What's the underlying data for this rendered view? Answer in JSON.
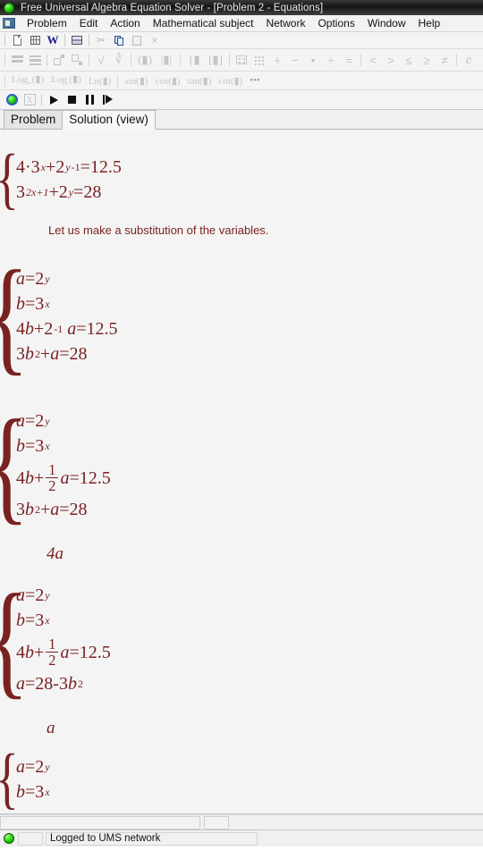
{
  "window": {
    "title": "Free Universal Algebra Equation Solver - [Problem 2 - Equations]",
    "orb_icon": "green-status-orb"
  },
  "menubar": {
    "system_icon": "app-system-icon",
    "items": [
      {
        "label": "Problem"
      },
      {
        "label": "Edit"
      },
      {
        "label": "Action"
      },
      {
        "label": "Mathematical subject"
      },
      {
        "label": "Network"
      },
      {
        "label": "Options"
      },
      {
        "label": "Window"
      },
      {
        "label": "Help"
      }
    ]
  },
  "toolbar_file": {
    "buttons": [
      {
        "name": "new-document-icon",
        "enabled": true
      },
      {
        "name": "table-icon",
        "enabled": true
      },
      {
        "name": "word-export-icon",
        "label": "W",
        "enabled": true
      },
      {
        "name": "print-icon",
        "enabled": true
      },
      {
        "name": "cut-icon",
        "label": "✂",
        "enabled": false
      },
      {
        "name": "copy-icon",
        "enabled": true
      },
      {
        "name": "paste-icon",
        "enabled": false
      },
      {
        "name": "delete-icon",
        "label": "×",
        "enabled": false
      }
    ]
  },
  "toolbar_format": {
    "buttons": [
      {
        "name": "two-row-layout-icon",
        "enabled": false
      },
      {
        "name": "three-row-layout-icon",
        "enabled": false
      },
      {
        "name": "superscript-icon",
        "enabled": false
      },
      {
        "name": "subscript-icon",
        "enabled": false
      },
      {
        "name": "square-root-icon",
        "label": "√",
        "enabled": false
      },
      {
        "name": "nth-root-icon",
        "label": "∛",
        "enabled": false
      },
      {
        "name": "parenthesis-icon",
        "label": "(▮)",
        "enabled": false
      },
      {
        "name": "absolute-value-icon",
        "label": "|▮|",
        "enabled": false
      },
      {
        "name": "brace-icon",
        "label": "{▮",
        "enabled": false
      },
      {
        "name": "bracket-icon",
        "label": "[▮]",
        "enabled": false
      },
      {
        "name": "matrix-small-icon",
        "enabled": false
      },
      {
        "name": "matrix-large-icon",
        "enabled": false
      },
      {
        "name": "plus-operator",
        "label": "+",
        "enabled": false
      },
      {
        "name": "minus-operator",
        "label": "−",
        "enabled": false
      },
      {
        "name": "multiply-operator",
        "label": "•",
        "enabled": false
      },
      {
        "name": "divide-operator",
        "label": "÷",
        "enabled": false
      },
      {
        "name": "equals-operator",
        "label": "=",
        "enabled": false
      },
      {
        "name": "less-than-operator",
        "label": "<",
        "enabled": false
      },
      {
        "name": "greater-than-operator",
        "label": ">",
        "enabled": false
      },
      {
        "name": "less-equal-operator",
        "label": "≤",
        "enabled": false
      },
      {
        "name": "greater-equal-operator",
        "label": "≥",
        "enabled": false
      },
      {
        "name": "not-equal-operator",
        "label": "≠",
        "enabled": false
      },
      {
        "name": "euler-constant",
        "label": "e",
        "enabled": false
      }
    ]
  },
  "toolbar_functions": {
    "buttons": [
      {
        "name": "log-base-icon",
        "label": "Log",
        "sub": "▫▫",
        "enabled": false
      },
      {
        "name": "log-icon",
        "label": "Log",
        "sub": "▫",
        "enabled": false
      },
      {
        "name": "natural-log-icon",
        "label": "Ln(▮)",
        "sub": "",
        "enabled": false
      },
      {
        "name": "sin-icon",
        "label": "sin(▮)",
        "sub": "",
        "enabled": false
      },
      {
        "name": "cos-icon",
        "label": "cos(▮)",
        "sub": "",
        "enabled": false
      },
      {
        "name": "tan-icon",
        "label": "tan(▮)",
        "sub": "",
        "enabled": false
      },
      {
        "name": "cot-icon",
        "label": "cot(▮)",
        "sub": "",
        "enabled": false
      },
      {
        "name": "more-functions-icon",
        "label": "•••",
        "sub": "",
        "enabled": true
      }
    ]
  },
  "toolbar_run": {
    "buttons": [
      {
        "name": "solve-status-orb",
        "enabled": true
      },
      {
        "name": "cancel-solve-icon",
        "label": "X",
        "enabled": false
      },
      {
        "name": "run-button",
        "enabled": true
      },
      {
        "name": "stop-button",
        "enabled": true
      },
      {
        "name": "pause-button",
        "enabled": true
      },
      {
        "name": "step-button",
        "enabled": true
      }
    ]
  },
  "tabs": {
    "items": [
      {
        "label": "Problem",
        "active": false
      },
      {
        "label": "Solution (view)",
        "active": true
      }
    ]
  },
  "solution": {
    "blocks": [
      {
        "kind": "system",
        "name": "original-system",
        "lines": [
          {
            "parts": [
              {
                "t": "n",
                "v": "4·3"
              },
              {
                "t": "sup-i",
                "v": "x"
              },
              {
                "t": "n",
                "v": "+2"
              },
              {
                "t": "sup-i",
                "v": "y"
              },
              {
                "t": "sup-n",
                "v": "-1"
              },
              {
                "t": "n",
                "v": "=12.5"
              }
            ]
          },
          {
            "parts": [
              {
                "t": "n",
                "v": "3"
              },
              {
                "t": "sup-i",
                "v": "2x+1"
              },
              {
                "t": "n",
                "v": "+2"
              },
              {
                "t": "sup-i",
                "v": "y"
              },
              {
                "t": "n",
                "v": "=28"
              }
            ]
          }
        ]
      },
      {
        "kind": "text",
        "name": "substitution-note",
        "text": "Let us make a substitution of the variables."
      },
      {
        "kind": "system",
        "name": "substituted-system",
        "lines": [
          {
            "parts": [
              {
                "t": "i",
                "v": "a"
              },
              {
                "t": "n",
                "v": "=2"
              },
              {
                "t": "sup-i",
                "v": "y"
              }
            ]
          },
          {
            "parts": [
              {
                "t": "i",
                "v": "b"
              },
              {
                "t": "n",
                "v": "=3"
              },
              {
                "t": "sup-i",
                "v": "x"
              }
            ]
          },
          {
            "parts": [
              {
                "t": "n",
                "v": "4"
              },
              {
                "t": "i",
                "v": "b"
              },
              {
                "t": "n",
                "v": "+2"
              },
              {
                "t": "sup-n",
                "v": "-1"
              },
              {
                "t": "sp",
                "v": " "
              },
              {
                "t": "i",
                "v": "a"
              },
              {
                "t": "n",
                "v": "=12.5"
              }
            ]
          },
          {
            "parts": [
              {
                "t": "n",
                "v": "3"
              },
              {
                "t": "i",
                "v": "b"
              },
              {
                "t": "sup-n",
                "v": "2"
              },
              {
                "t": "n",
                "v": "+"
              },
              {
                "t": "i",
                "v": "a"
              },
              {
                "t": "n",
                "v": "=28"
              }
            ]
          }
        ]
      },
      {
        "kind": "system",
        "name": "fraction-system",
        "lines": [
          {
            "parts": [
              {
                "t": "i",
                "v": "a"
              },
              {
                "t": "n",
                "v": "=2"
              },
              {
                "t": "sup-i",
                "v": "y"
              }
            ]
          },
          {
            "parts": [
              {
                "t": "i",
                "v": "b"
              },
              {
                "t": "n",
                "v": "=3"
              },
              {
                "t": "sup-i",
                "v": "x"
              }
            ]
          },
          {
            "parts": [
              {
                "t": "n",
                "v": "4"
              },
              {
                "t": "i",
                "v": "b"
              },
              {
                "t": "n",
                "v": "+"
              },
              {
                "t": "frac",
                "num": "1",
                "den": "2"
              },
              {
                "t": "i",
                "v": "a"
              },
              {
                "t": "n",
                "v": "=12.5"
              }
            ]
          },
          {
            "parts": [
              {
                "t": "n",
                "v": "3"
              },
              {
                "t": "i",
                "v": "b"
              },
              {
                "t": "sup-n",
                "v": "2"
              },
              {
                "t": "n",
                "v": "+"
              },
              {
                "t": "i",
                "v": "a"
              },
              {
                "t": "n",
                "v": "=28"
              }
            ]
          }
        ]
      },
      {
        "kind": "stepvar",
        "name": "step-marker-4a",
        "text": "4a"
      },
      {
        "kind": "system",
        "name": "isolated-a-system",
        "lines": [
          {
            "parts": [
              {
                "t": "i",
                "v": "a"
              },
              {
                "t": "n",
                "v": "=2"
              },
              {
                "t": "sup-i",
                "v": "y"
              }
            ]
          },
          {
            "parts": [
              {
                "t": "i",
                "v": "b"
              },
              {
                "t": "n",
                "v": "=3"
              },
              {
                "t": "sup-i",
                "v": "x"
              }
            ]
          },
          {
            "parts": [
              {
                "t": "n",
                "v": "4"
              },
              {
                "t": "i",
                "v": "b"
              },
              {
                "t": "n",
                "v": "+"
              },
              {
                "t": "frac",
                "num": "1",
                "den": "2"
              },
              {
                "t": "i",
                "v": "a"
              },
              {
                "t": "n",
                "v": "=12.5"
              }
            ]
          },
          {
            "parts": [
              {
                "t": "i",
                "v": "a"
              },
              {
                "t": "n",
                "v": "=28-3"
              },
              {
                "t": "i",
                "v": "b"
              },
              {
                "t": "sup-n",
                "v": "2"
              }
            ]
          }
        ]
      },
      {
        "kind": "stepvar",
        "name": "step-marker-a",
        "text": "a"
      },
      {
        "kind": "system",
        "name": "partial-system",
        "lines": [
          {
            "parts": [
              {
                "t": "i",
                "v": "a"
              },
              {
                "t": "n",
                "v": "=2"
              },
              {
                "t": "sup-i",
                "v": "y"
              }
            ]
          },
          {
            "parts": [
              {
                "t": "i",
                "v": "b"
              },
              {
                "t": "n",
                "v": "=3"
              },
              {
                "t": "sup-i",
                "v": "x"
              }
            ]
          }
        ]
      }
    ]
  },
  "scrollbar": {
    "name": "horizontal-scrollbar"
  },
  "statusbar": {
    "orb_icon": "network-status-orb",
    "message": "Logged to UMS network"
  },
  "colors": {
    "math_text": "#7a2222",
    "titlebar_dark": "#1d1d1d",
    "content_bg": "#f4f4f4",
    "accent_green": "#22d40a"
  }
}
